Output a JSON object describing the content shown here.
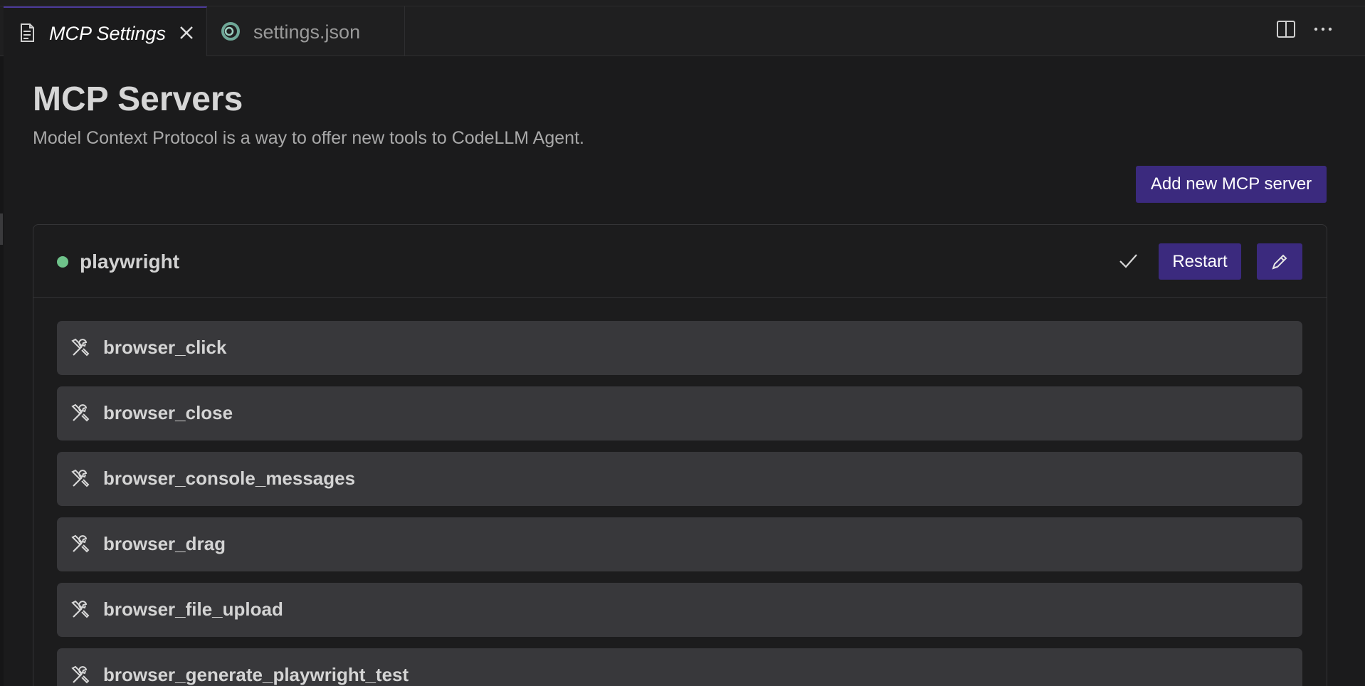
{
  "tabs": [
    {
      "label": "MCP Settings",
      "icon": "document-icon",
      "active": true,
      "closable": true
    },
    {
      "label": "settings.json",
      "icon": "codellm-logo-icon",
      "active": false
    }
  ],
  "tabbar_actions": [
    {
      "icon": "split-editor-icon"
    },
    {
      "icon": "more-actions-icon"
    }
  ],
  "page": {
    "title": "MCP Servers",
    "subtitle": "Model Context Protocol is a way to offer new tools to CodeLLM Agent.",
    "add_button_label": "Add new MCP server"
  },
  "server": {
    "name": "playwright",
    "status": "connected",
    "status_color": "#6fc38b",
    "restart_label": "Restart",
    "tools": [
      {
        "name": "browser_click"
      },
      {
        "name": "browser_close"
      },
      {
        "name": "browser_console_messages"
      },
      {
        "name": "browser_drag"
      },
      {
        "name": "browser_file_upload"
      },
      {
        "name": "browser_generate_playwright_test"
      }
    ]
  },
  "colors": {
    "accent": "#3b2a7e",
    "background": "#1b1b1c",
    "tool_row": "#38383b"
  }
}
